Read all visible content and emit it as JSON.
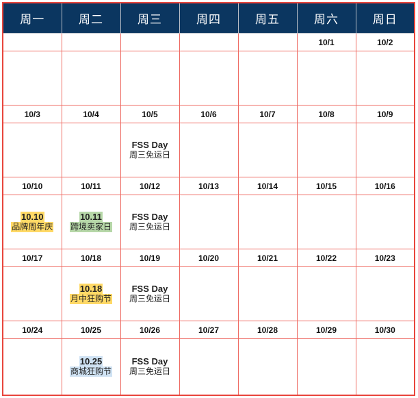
{
  "header": {
    "weekdays": [
      "周一",
      "周二",
      "周三",
      "周四",
      "周五",
      "周六",
      "周日"
    ],
    "header_bg": "#0b3660",
    "grid_color": "#e8453c"
  },
  "weeks": [
    {
      "dates": [
        "",
        "",
        "",
        "",
        "",
        "10/1",
        "10/2"
      ]
    },
    {
      "dates": [
        "10/3",
        "10/4",
        "10/5",
        "10/6",
        "10/7",
        "10/8",
        "10/9"
      ]
    },
    {
      "dates": [
        "10/10",
        "10/11",
        "10/12",
        "10/13",
        "10/14",
        "10/15",
        "10/16"
      ]
    },
    {
      "dates": [
        "10/17",
        "10/18",
        "10/19",
        "10/20",
        "10/21",
        "10/22",
        "10/23"
      ]
    },
    {
      "dates": [
        "10/24",
        "10/25",
        "10/26",
        "10/27",
        "10/28",
        "10/29",
        "10/30"
      ]
    }
  ],
  "events": {
    "fss": {
      "title": "FSS Day",
      "subtitle": "周三免运日"
    },
    "brand_anniversary": {
      "title": "10.10",
      "subtitle": "品牌周年庆",
      "highlight": "#ffd966"
    },
    "cross_border_seller_day": {
      "title": "10.11",
      "subtitle": "跨境卖家日",
      "highlight": "#b6d7a8"
    },
    "mid_month_sale": {
      "title": "10.18",
      "subtitle": "月中狂购节",
      "highlight": "#ffd966"
    },
    "mall_sale": {
      "title": "10.25",
      "subtitle": "商城狂购节",
      "highlight": "#cfe2f3"
    }
  }
}
